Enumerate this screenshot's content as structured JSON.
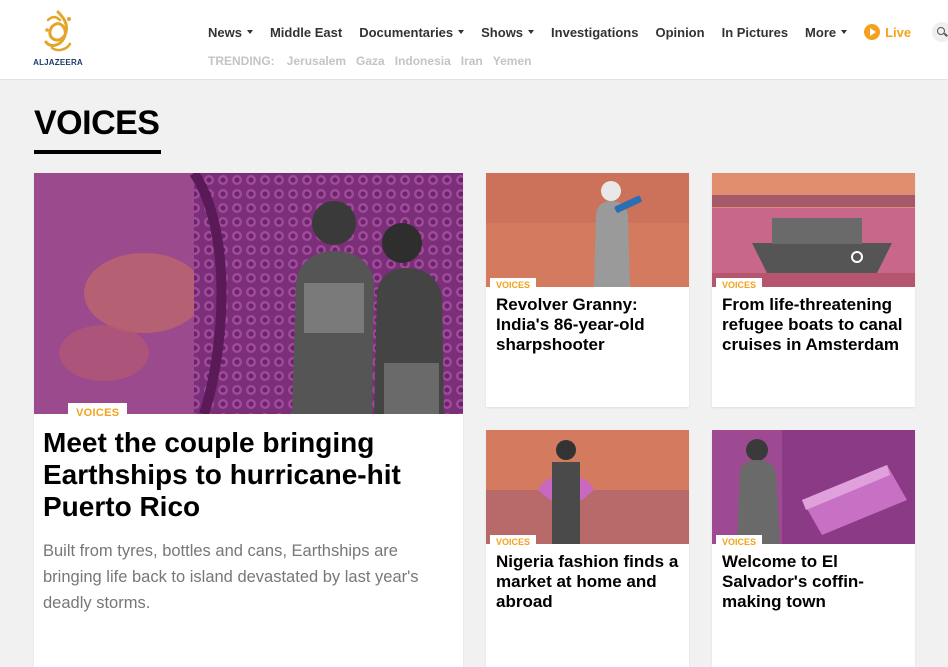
{
  "header": {
    "logo_text": "ALJAZEERA",
    "nav": [
      {
        "label": "News",
        "dropdown": true
      },
      {
        "label": "Middle East",
        "dropdown": false
      },
      {
        "label": "Documentaries",
        "dropdown": true
      },
      {
        "label": "Shows",
        "dropdown": true
      },
      {
        "label": "Investigations",
        "dropdown": false
      },
      {
        "label": "Opinion",
        "dropdown": false
      },
      {
        "label": "In Pictures",
        "dropdown": false
      },
      {
        "label": "More",
        "dropdown": true
      }
    ],
    "live_label": "Live",
    "trending_label": "TRENDING:",
    "trending": [
      "Jerusalem",
      "Gaza",
      "Indonesia",
      "Iran",
      "Yemen"
    ]
  },
  "section": {
    "title": "VOICES"
  },
  "featured": {
    "tag": "VOICES",
    "headline": "Meet the couple bringing Earthships to hurricane-hit Puerto Rico",
    "summary": "Built from tyres, bottles and cans, Earthships are bringing life back to island devastated by last year's deadly storms."
  },
  "cards": [
    {
      "tag": "VOICES",
      "headline": "Revolver Granny: India's 86-year-old sharpshooter"
    },
    {
      "tag": "VOICES",
      "headline": "From life-threatening refugee boats to canal cruises in Amsterdam"
    },
    {
      "tag": "VOICES",
      "headline": "Nigeria fashion finds a market at home and abroad"
    },
    {
      "tag": "VOICES",
      "headline": "Welcome to El Salvador's coffin-making town"
    }
  ],
  "colors": {
    "accent": "#f4a11d",
    "brand_blue": "#1a3a6b",
    "thumb_purple": "#8b3a86",
    "thumb_orange": "#d97a5a"
  }
}
